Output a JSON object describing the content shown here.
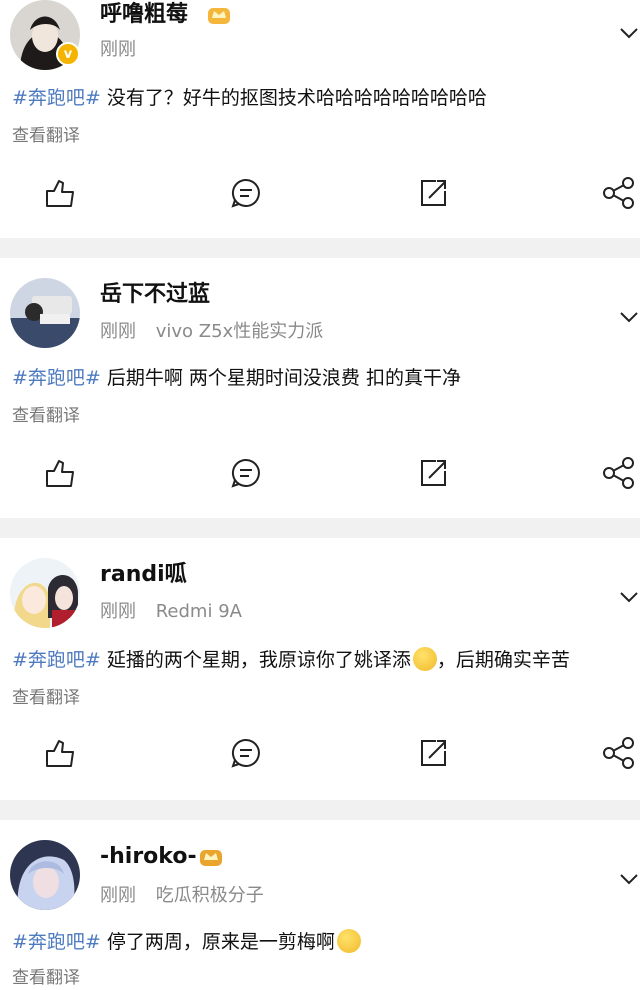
{
  "posts": [
    {
      "username": "呼噜粗莓",
      "time": "刚刚",
      "device": "",
      "topic": "#奔跑吧#",
      "text": " 没有了？好牛的抠图技术哈哈哈哈哈哈哈哈哈",
      "translate": "查看翻译"
    },
    {
      "username": "岳下不过蓝",
      "time": "刚刚",
      "device": "vivo Z5x性能实力派",
      "topic": "#奔跑吧#",
      "text": " 后期牛啊 两个星期时间没浪费 扣的真干净",
      "translate": "查看翻译"
    },
    {
      "username": "randi呱",
      "time": "刚刚",
      "device": "Redmi 9A",
      "topic": "#奔跑吧#",
      "text": " 延播的两个星期，我原谅你了姚译添",
      "text_after": "，后期确实辛苦",
      "translate": "查看翻译"
    },
    {
      "username": "-hiroko-",
      "time": "刚刚",
      "device": "吃瓜积极分子",
      "topic": "#奔跑吧#",
      "text": " 停了两周，原来是一剪梅啊",
      "translate": "查看翻译"
    }
  ],
  "icons": {
    "like": "like-icon",
    "comment": "comment-icon",
    "repost": "repost-icon",
    "share": "share-icon",
    "more": "chevron-down-icon"
  },
  "colors": {
    "topic": "#4e7bc0",
    "meta": "#8a8a8a",
    "divider": "#f1f1f1"
  }
}
